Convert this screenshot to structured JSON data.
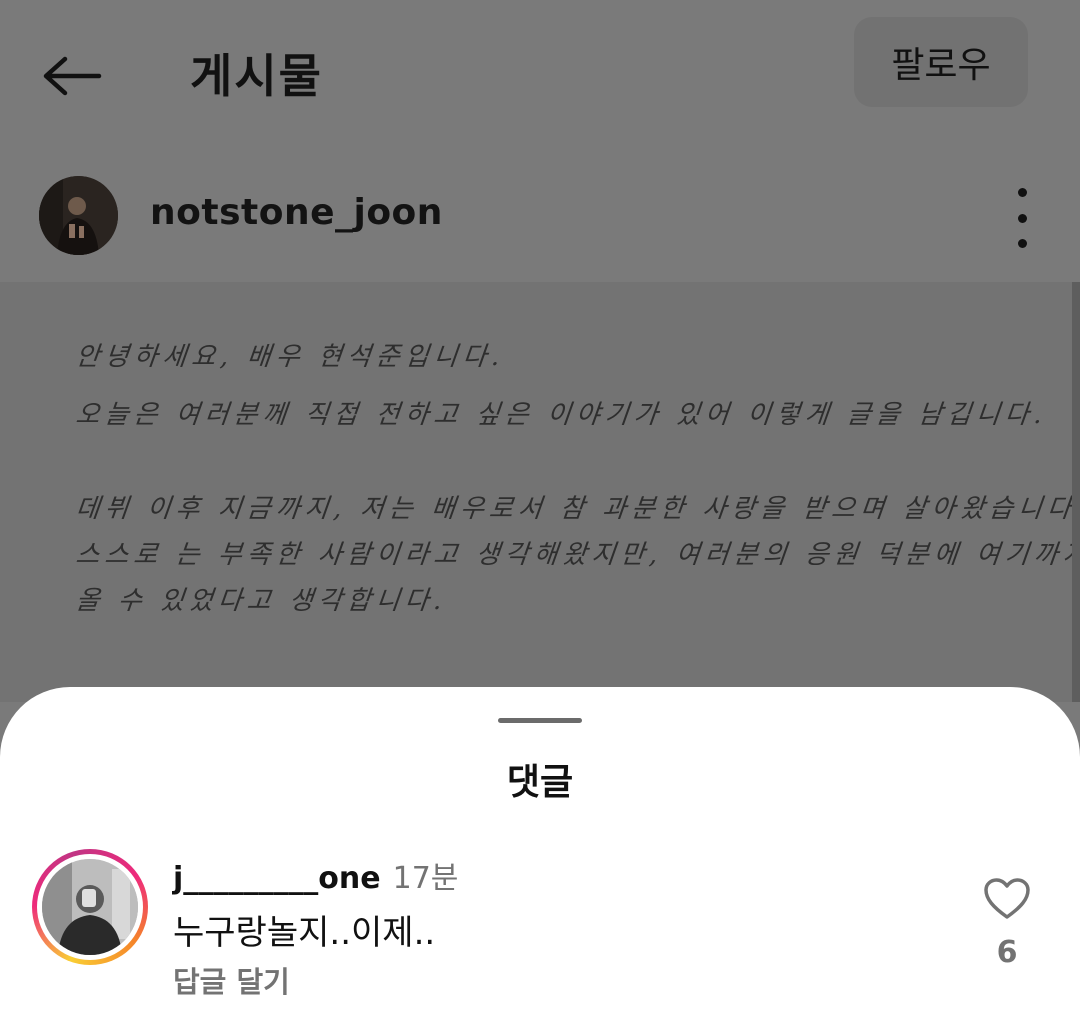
{
  "header": {
    "title": "게시물",
    "follow_label": "팔로우"
  },
  "post": {
    "author": "notstone_joon",
    "letter_lines": [
      "안녕하세요,  배우  현석준입니다.",
      "오늘은  여러분께  직접  전하고  싶은  이야기가  있어  이렇게  글을  남깁니다.",
      "데뷔  이후  지금까지,  저는  배우로서  참  과분한  사랑을  받으며  살아왔습니다.",
      "스스로  는  부족한  사람이라고  생각해왔지만,  여러분의  응원  덕분에  여기까지",
      "올  수  있었다고  생각합니다."
    ]
  },
  "comments_sheet": {
    "title": "댓글",
    "comments": [
      {
        "username": "j_________one",
        "time": "17분",
        "text": "누구랑놀지..이제..",
        "reply_label": "답글 달기",
        "likes": "6"
      }
    ]
  },
  "colors": {
    "dim_background": "#7a7a7a",
    "sheet_background": "#ffffff",
    "secondary_text": "#737373",
    "story_ring": [
      "#f9ce34",
      "#ee2a7b",
      "#c13584"
    ]
  },
  "icons": {
    "back": "arrow-left-icon",
    "more": "more-vertical-icon",
    "like": "heart-outline-icon"
  }
}
